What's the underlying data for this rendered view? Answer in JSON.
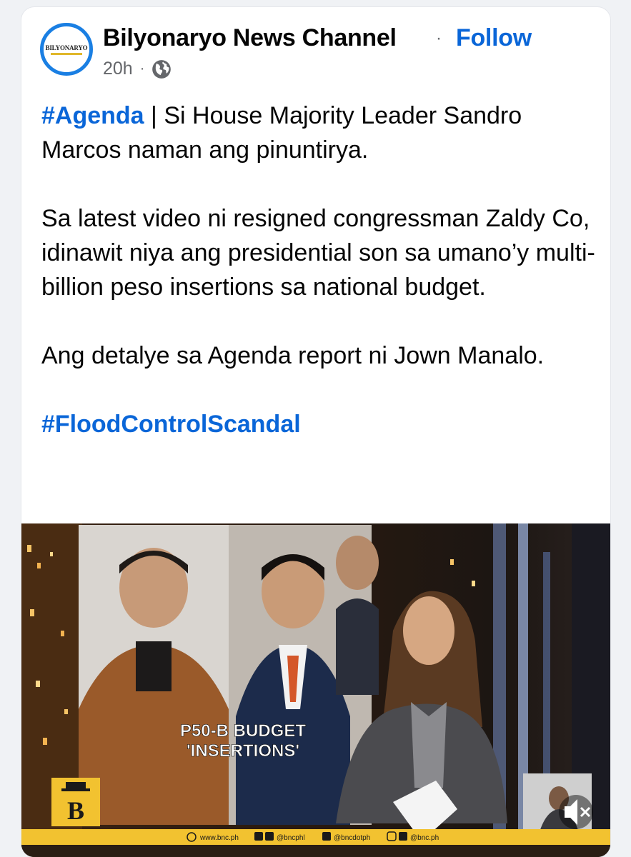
{
  "post": {
    "page_name": "Bilyonaryo News Channel",
    "separator": "·",
    "follow_label": "Follow",
    "time": "20h",
    "meta_separator": "·",
    "avatar_text": "BILYONARYO",
    "audience_icon": "globe-icon",
    "text": {
      "tag1": "#Agenda",
      "pipe": "|",
      "line1_rest": " Si House Majority Leader Sandro Marcos naman ang pinuntirya.",
      "para2": "Sa latest video ni resigned congressman Zaldy Co, idinawit niya ang presidential son sa umano’y multi-billion peso insertions sa national budget.",
      "para3": "Ang detalye sa Agenda report ni Jown Manalo.",
      "tag2": "#FloodControlScandal"
    }
  },
  "video": {
    "lower_third_line1": "P50-B BUDGET",
    "lower_third_line2": "'INSERTIONS'",
    "logo_letter": "B",
    "footer_website": "www.bnc.ph",
    "footer_handle1": "@bncphl",
    "footer_handle2": "@bncdotph",
    "footer_handle3": "@bnc.ph",
    "mute_icon": "speaker-muted-icon"
  },
  "colors": {
    "accent": "#0a66d8",
    "avatar_ring": "#1a7fe3",
    "channel_gold": "#f2c230",
    "text": "#050505",
    "muted": "#65676b"
  }
}
